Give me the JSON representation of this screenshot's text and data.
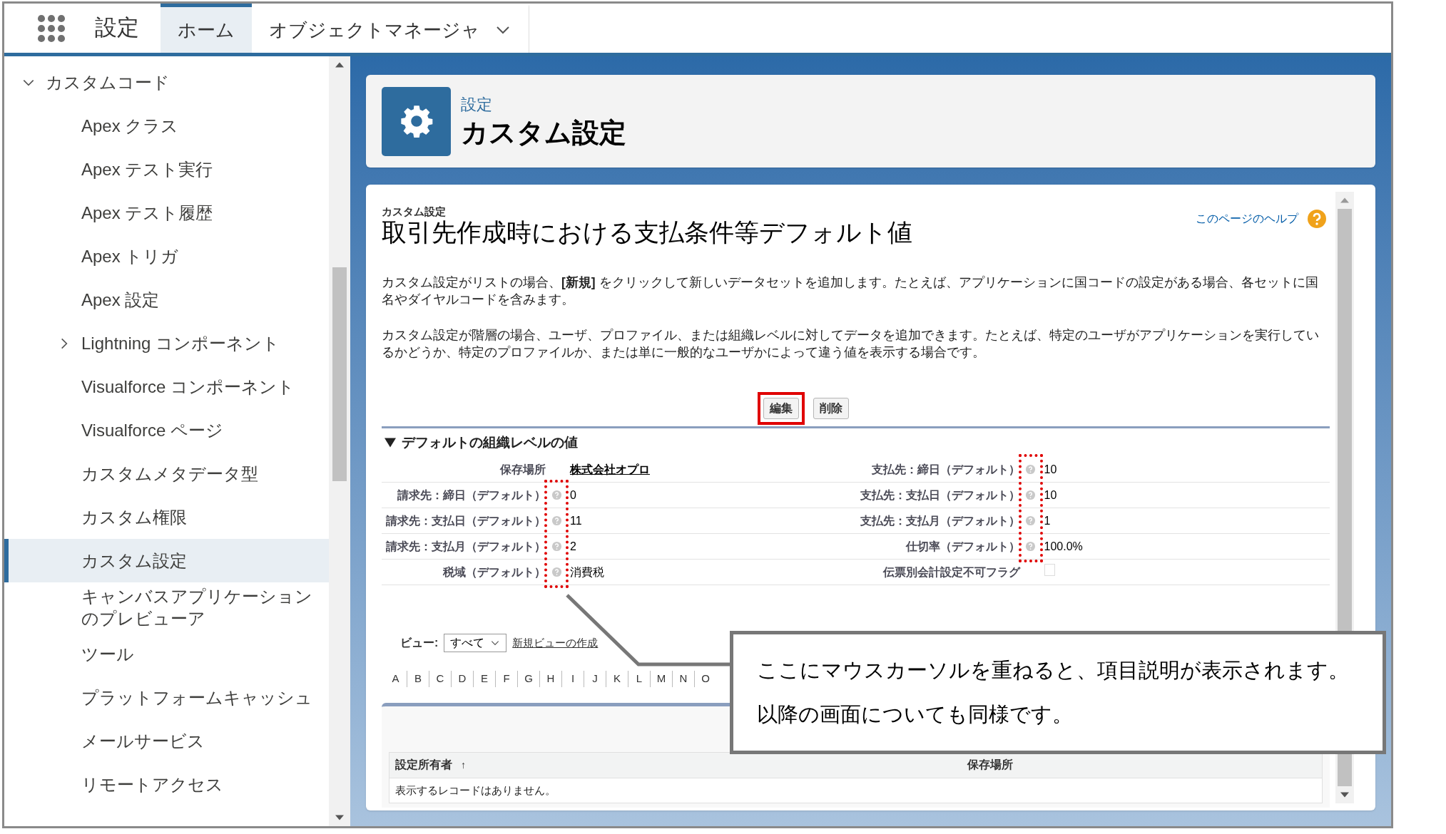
{
  "app_bar": {
    "app_name": "設定",
    "tabs": [
      {
        "label": "ホーム",
        "selected": true,
        "has_menu": false
      },
      {
        "label": "オブジェクトマネージャ",
        "selected": false,
        "has_menu": true
      }
    ]
  },
  "sidebar": {
    "items": [
      {
        "label": "カスタムコード",
        "expanded": true,
        "selected": false,
        "children": [
          {
            "label": "Apex クラス",
            "selected": false
          },
          {
            "label": "Apex テスト実行",
            "selected": false
          },
          {
            "label": "Apex テスト履歴",
            "selected": false
          },
          {
            "label": "Apex トリガ",
            "selected": false
          },
          {
            "label": "Apex 設定",
            "selected": false
          },
          {
            "label": "Lightning コンポーネント",
            "selected": false,
            "expanded": false
          },
          {
            "label": "Visualforce コンポーネント",
            "selected": false
          },
          {
            "label": "Visualforce ページ",
            "selected": false
          },
          {
            "label": "カスタムメタデータ型",
            "selected": false
          },
          {
            "label": "カスタム権限",
            "selected": false
          },
          {
            "label": "カスタム設定",
            "selected": true
          },
          {
            "label": "キャンバスアプリケーションのプレビューア",
            "selected": false
          },
          {
            "label": "ツール",
            "selected": false
          },
          {
            "label": "プラットフォームキャッシュ",
            "selected": false
          },
          {
            "label": "メールサービス",
            "selected": false
          },
          {
            "label": "リモートアクセス",
            "selected": false
          }
        ]
      }
    ]
  },
  "page_header": {
    "breadcrumb": "設定",
    "title": "カスタム設定"
  },
  "detail": {
    "eyebrow": "カスタム設定",
    "title": "取引先作成時における支払条件等デフォルト値",
    "help_link": "このページのヘルプ",
    "paragraphs": [
      "カスタム設定がリストの場合、**[新規]** をクリックして新しいデータセットを追加します。たとえば、アプリケーションに国コードの設定がある場合、各セットに国名やダイヤルコードを含みます。",
      "カスタム設定が階層の場合、ユーザ、プロファイル、または組織レベルに対してデータを追加できます。たとえば、特定のユーザがアプリケーションを実行しているかどうか、特定のプロファイルか、または単に一般的なユーザかによって違う値を表示する場合です。"
    ],
    "buttons": [
      {
        "label": "編集",
        "highlighted": true
      },
      {
        "label": "削除",
        "highlighted": false
      }
    ],
    "section": {
      "title": "デフォルトの組織レベルの値",
      "expanded": true,
      "columns": [
        {
          "highlighted": true,
          "fields": [
            {
              "label": "保存場所",
              "kind": "link",
              "value": "株式会社オプロ",
              "help": false
            },
            {
              "label": "請求先：締日（デフォルト）",
              "kind": "text",
              "value": "0",
              "help": true
            },
            {
              "label": "請求先：支払日（デフォルト）",
              "kind": "text",
              "value": "11",
              "help": true
            },
            {
              "label": "請求先：支払月（デフォルト）",
              "kind": "text",
              "value": "2",
              "help": true
            },
            {
              "label": "税域（デフォルト）",
              "kind": "text",
              "value": "消費税",
              "help": true
            }
          ]
        },
        {
          "highlighted": true,
          "fields": [
            {
              "label": "支払先：締日（デフォルト）",
              "kind": "text",
              "value": "10",
              "help": true
            },
            {
              "label": "支払先：支払日（デフォルト）",
              "kind": "text",
              "value": "10",
              "help": true
            },
            {
              "label": "支払先：支払月（デフォルト）",
              "kind": "text",
              "value": "1",
              "help": true
            },
            {
              "label": "仕切率（デフォルト）",
              "kind": "text",
              "value": "100.0%",
              "help": true
            },
            {
              "label": "伝票別会計設定不可フラグ",
              "kind": "checkbox",
              "checked": false,
              "help": false
            }
          ]
        }
      ]
    },
    "view": {
      "label": "ビュー:",
      "selected_view": "すべて",
      "create_link": "新規ビューの作成"
    },
    "alphabet": [
      "A",
      "B",
      "C",
      "D",
      "E",
      "F",
      "G",
      "H",
      "I",
      "J",
      "K",
      "L",
      "M",
      "N",
      "O"
    ],
    "table": {
      "columns": [
        {
          "label": "設定所有者",
          "sort_mark": "↑"
        },
        {
          "label": "保存場所"
        }
      ],
      "empty_message": "表示するレコードはありません。"
    }
  },
  "callout": {
    "lines": [
      "ここにマウスカーソルを重ねると、項目説明が表示されます。",
      "以降の画面についても同様です。"
    ]
  }
}
